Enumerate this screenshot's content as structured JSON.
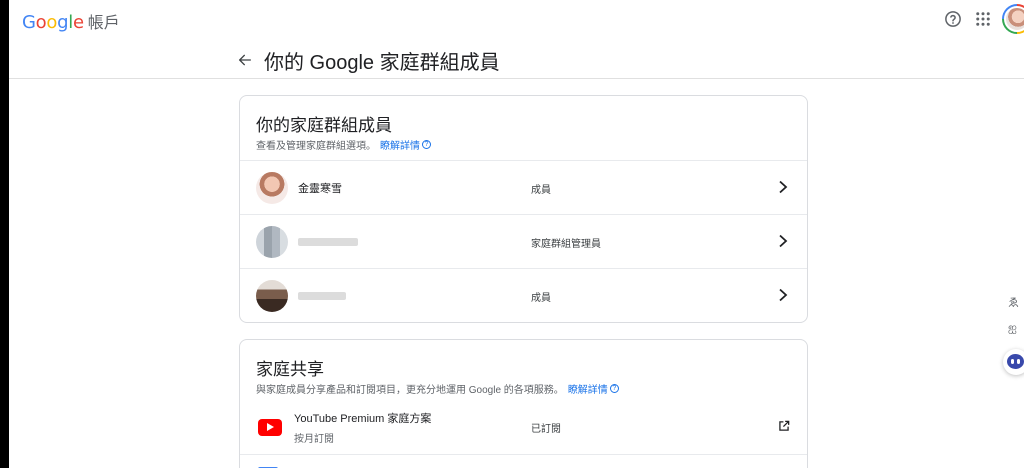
{
  "brand": {
    "logo_text": "Google",
    "account_label": "帳戶"
  },
  "colors": {
    "google_blue": "#4285F4",
    "google_red": "#EA4335",
    "google_yellow": "#FBBC05",
    "google_green": "#34A853",
    "link": "#1a73e8",
    "youtube_red": "#ff0000"
  },
  "header_icons": {
    "help": "help-icon",
    "apps": "apps-grid-icon",
    "account": "account-avatar"
  },
  "page": {
    "title": "你的 Google 家庭群組成員"
  },
  "members_card": {
    "title": "你的家庭群組成員",
    "subtitle": "查看及管理家庭群組選項。",
    "learn_more": "瞭解詳情",
    "members": [
      {
        "name": "金靈寒雪",
        "role": "成員"
      },
      {
        "name": "",
        "role": "家庭群組管理員"
      },
      {
        "name": "",
        "role": "成員"
      }
    ]
  },
  "sharing_card": {
    "title": "家庭共享",
    "subtitle": "與家庭成員分享產品和訂閱項目，更充分地運用 Google 的各項服務。",
    "learn_more": "瞭解詳情",
    "services": [
      {
        "name": "YouTube Premium 家庭方案",
        "billing": "按月訂閱",
        "status": "已訂閱"
      }
    ]
  },
  "side_tools": [
    "ゑ",
    "ஐ"
  ]
}
